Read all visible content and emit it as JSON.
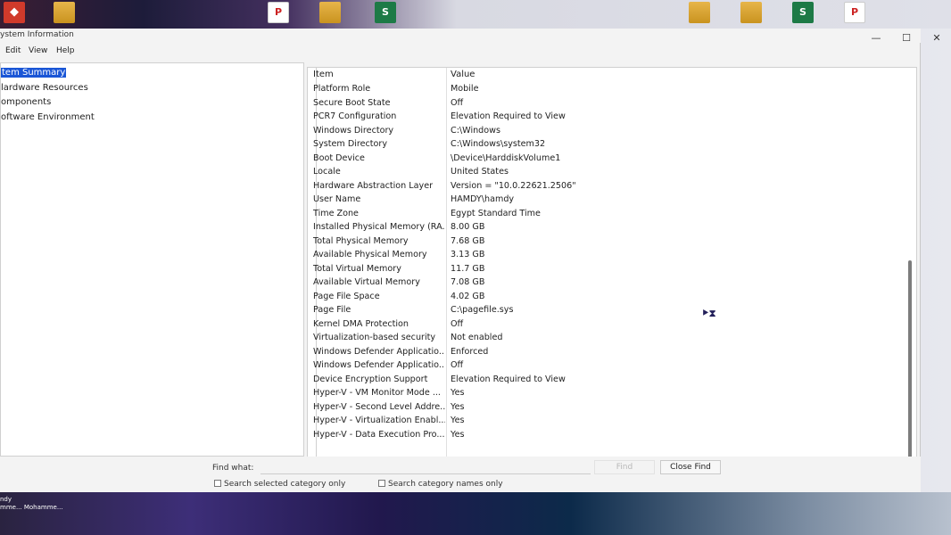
{
  "window": {
    "title": "ystem Information",
    "controls": {
      "minimize": "—",
      "maximize": "☐",
      "close": "✕"
    }
  },
  "menu": [
    "Edit",
    "View",
    "Help"
  ],
  "tree": [
    {
      "label": "tem Summary",
      "selected": true
    },
    {
      "label": "lardware Resources",
      "selected": false
    },
    {
      "label": "omponents",
      "selected": false
    },
    {
      "label": "oftware Environment",
      "selected": false
    }
  ],
  "table": {
    "headers": {
      "item": "Item",
      "value": "Value"
    },
    "rows": [
      {
        "item": "Platform Role",
        "value": "Mobile"
      },
      {
        "item": "Secure Boot State",
        "value": "Off"
      },
      {
        "item": "PCR7 Configuration",
        "value": "Elevation Required to View"
      },
      {
        "item": "Windows Directory",
        "value": "C:\\Windows"
      },
      {
        "item": "System Directory",
        "value": "C:\\Windows\\system32"
      },
      {
        "item": "Boot Device",
        "value": "\\Device\\HarddiskVolume1"
      },
      {
        "item": "Locale",
        "value": "United States"
      },
      {
        "item": "Hardware Abstraction Layer",
        "value": "Version = \"10.0.22621.2506\""
      },
      {
        "item": "User Name",
        "value": "HAMDY\\hamdy"
      },
      {
        "item": "Time Zone",
        "value": "Egypt Standard Time"
      },
      {
        "item": "Installed Physical Memory (RA...",
        "value": "8.00 GB"
      },
      {
        "item": "Total Physical Memory",
        "value": "7.68 GB"
      },
      {
        "item": "Available Physical Memory",
        "value": "3.13 GB"
      },
      {
        "item": "Total Virtual Memory",
        "value": "11.7 GB"
      },
      {
        "item": "Available Virtual Memory",
        "value": "7.08 GB"
      },
      {
        "item": "Page File Space",
        "value": "4.02 GB"
      },
      {
        "item": "Page File",
        "value": "C:\\pagefile.sys"
      },
      {
        "item": "Kernel DMA Protection",
        "value": "Off"
      },
      {
        "item": "Virtualization-based security",
        "value": "Not enabled"
      },
      {
        "item": "Windows Defender Applicatio...",
        "value": "Enforced"
      },
      {
        "item": "Windows Defender Applicatio...",
        "value": "Off"
      },
      {
        "item": "Device Encryption Support",
        "value": "Elevation Required to View"
      },
      {
        "item": "Hyper-V - VM Monitor Mode ...",
        "value": "Yes"
      },
      {
        "item": "Hyper-V - Second Level Addre...",
        "value": "Yes"
      },
      {
        "item": "Hyper-V - Virtualization Enabl...",
        "value": "Yes"
      },
      {
        "item": "Hyper-V - Data Execution Pro...",
        "value": "Yes"
      }
    ]
  },
  "find": {
    "label": "Find what:",
    "input_value": "",
    "find_button": "Find",
    "close_find_button": "Close Find",
    "option_selected_category": "Search selected category only",
    "option_category_names": "Search category names only"
  },
  "desktop": {
    "taskbar_label_1": "ndy",
    "taskbar_label_2": "mme...   Mohamme..."
  },
  "icons": {
    "sheet_letter": "S",
    "pdf_letter": "P"
  }
}
